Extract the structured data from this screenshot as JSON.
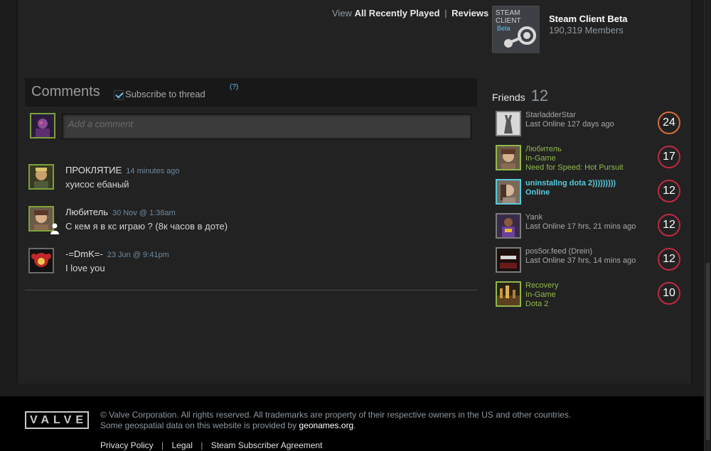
{
  "view_links": {
    "prefix": "View",
    "recently_played": "All Recently Played",
    "separator": "|",
    "reviews": "Reviews"
  },
  "group": {
    "logo_line1": "STEAM",
    "logo_line2": "CLIENT",
    "logo_line3": "Beta",
    "name": "Steam Client Beta",
    "members": "190,319 Members"
  },
  "comments": {
    "title": "Comments",
    "subscribe_label": "Subscribe to thread",
    "help": "(?)",
    "input_placeholder": "Add a comment",
    "items": [
      {
        "author": "ПРОКЛЯТИЕ",
        "time": "14 minutes ago",
        "text": "хуисос ебаный"
      },
      {
        "author": "Любитель",
        "time": "30 Nov @ 1:38am",
        "text": "С кем я в кс играю ? (8к часов в доте)"
      },
      {
        "author": "-=DmK=-",
        "time": "23 Jun @ 9:41pm",
        "text": "I love you"
      }
    ]
  },
  "friends": {
    "heading": "Friends",
    "count": "12",
    "items": [
      {
        "name": "StarladderStar",
        "status": "Last Online 127 days ago",
        "game": "",
        "level": "24",
        "state": "offline"
      },
      {
        "name": "Любитель",
        "status": "In-Game",
        "game": "Need for Speed: Hot Pursuit",
        "level": "17",
        "state": "ingame"
      },
      {
        "name": "uninstallng dota 2)))))))))",
        "status": "Online",
        "game": "",
        "level": "12",
        "state": "online"
      },
      {
        "name": "Yank",
        "status": "Last Online 17 hrs, 21 mins ago",
        "game": "",
        "level": "12",
        "state": "offline"
      },
      {
        "name": "pos5or.feed (Drein)",
        "status": "Last Online 37 hrs, 14 mins ago",
        "game": "",
        "level": "12",
        "state": "offline"
      },
      {
        "name": "Recovery",
        "status": "In-Game",
        "game": "Dota 2",
        "level": "10",
        "state": "ingame"
      }
    ]
  },
  "footer": {
    "logo": "VALVE",
    "copyright": "© Valve Corporation. All rights reserved. All trademarks are property of their respective owners in the US and other countries.",
    "geo_prefix": "Some geospatial data on this website is provided by",
    "geo_link": "geonames.org",
    "geo_suffix": ".",
    "links": [
      "Privacy Policy",
      "Legal",
      "Steam Subscriber Agreement"
    ],
    "link_separator": "|"
  },
  "colors": {
    "accent_blue": "#66c0f4",
    "ingame_green": "#8fb94b",
    "online_blue": "#57cbde",
    "level_red": "#c02942",
    "level_orange": "#d76c41"
  }
}
